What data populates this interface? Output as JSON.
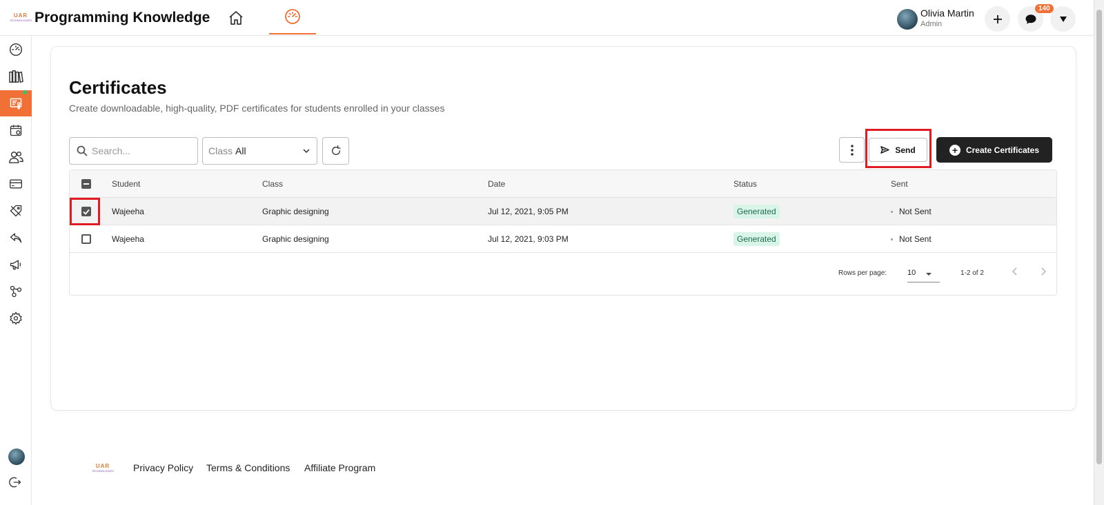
{
  "header": {
    "logo_line1": "UAR",
    "logo_line2": "TECHNOLOGIES",
    "app_title": "Programming Knowledge",
    "user_name": "Olivia Martin",
    "user_role": "Admin",
    "message_badge": "140"
  },
  "page": {
    "title": "Certificates",
    "subtitle": "Create downloadable, high-quality, PDF certificates for students enrolled in your classes"
  },
  "toolbar": {
    "search_placeholder": "Search...",
    "class_label": "Class",
    "class_value": "All",
    "send_label": "Send",
    "create_label": "Create Certificates"
  },
  "table": {
    "columns": [
      "Student",
      "Class",
      "Date",
      "Status",
      "Sent"
    ],
    "rows": [
      {
        "student": "Wajeeha",
        "class": "Graphic designing",
        "date": "Jul 12, 2021, 9:05 PM",
        "status": "Generated",
        "sent": "Not Sent",
        "checked": true
      },
      {
        "student": "Wajeeha",
        "class": "Graphic designing",
        "date": "Jul 12, 2021, 9:03 PM",
        "status": "Generated",
        "sent": "Not Sent",
        "checked": false
      }
    ],
    "rows_per_page_label": "Rows per page:",
    "rows_per_page_value": "10",
    "range_label": "1-2 of 2"
  },
  "footer": {
    "logo_line1": "UAR",
    "logo_line2": "TECHNOLOGIES",
    "links": [
      "Privacy Policy",
      "Terms & Conditions",
      "Affiliate Program"
    ]
  },
  "colors": {
    "accent": "#f07035",
    "highlight": "#e01b24",
    "status_bg": "#d9f5ea",
    "primary_button": "#222222"
  },
  "sidebar": {
    "icons": [
      "dashboard-icon",
      "library-icon",
      "certificates-icon",
      "calendar-icon",
      "users-icon",
      "payment-icon",
      "coupon-icon",
      "reply-icon",
      "megaphone-icon",
      "integrations-icon",
      "settings-icon"
    ]
  }
}
